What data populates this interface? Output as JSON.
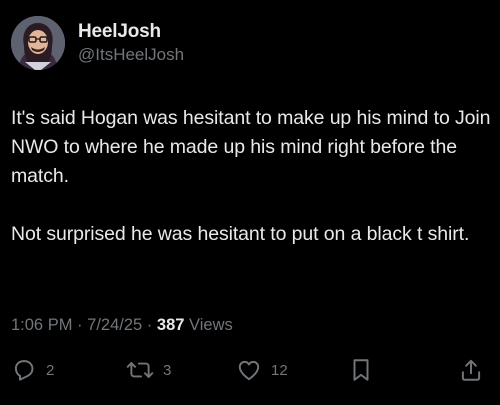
{
  "author": {
    "display_name": "HeelJosh",
    "handle": "@ItsHeelJosh"
  },
  "tweet": {
    "paragraphs": [
      "It's said Hogan was hesitant to make up his mind to Join NWO to where he made up his mind right before the match.",
      "Not surprised he was hesitant to put on a black t shirt."
    ],
    "time": "1:06 PM",
    "separator": "·",
    "date": "7/24/25",
    "views_count": "387",
    "views_label": "Views"
  },
  "actions": {
    "replies": "2",
    "reposts": "3",
    "likes": "12"
  },
  "icons": {
    "reply": "reply-icon",
    "repost": "repost-icon",
    "like": "heart-icon",
    "bookmark": "bookmark-icon",
    "share": "share-icon"
  },
  "colors": {
    "background": "#000000",
    "primary_text": "#e7e9ea",
    "secondary_text": "#71767b"
  }
}
